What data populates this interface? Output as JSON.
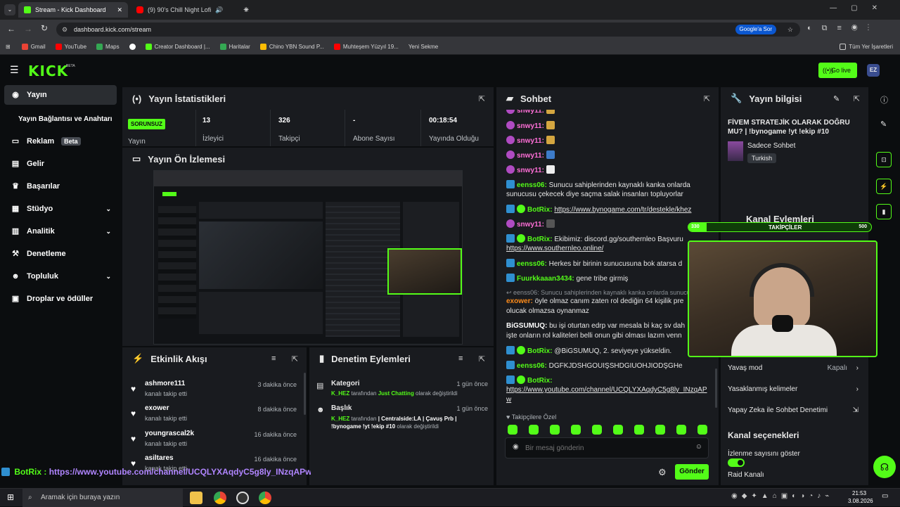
{
  "browser": {
    "tabs": [
      {
        "label": "Stream - Kick Dashboard"
      },
      {
        "label": "(9) 90's Chill Night Lofi"
      }
    ],
    "new_tab": "+",
    "url": "dashboard.kick.com/stream",
    "google_btn": "Google'a Sor",
    "bookmarks": [
      "Gmail",
      "YouTube",
      "Maps",
      "Creator Dashboard |...",
      "Haritalar",
      "Chino YBN Sound P...",
      "Muhteşem Yüzyıl 19...",
      "Yeni Sekme"
    ],
    "all_bookmarks": "Tüm Yer İşaretleri"
  },
  "app": {
    "logo": "KICK",
    "logo_beta": "BETA",
    "go_live": "Go live",
    "avatar": "EZ",
    "accent": "#53fc18"
  },
  "sidebar": {
    "items": [
      {
        "label": "Yayın",
        "icon": "broadcast-icon"
      },
      {
        "label": "Yayın Bağlantısı ve Anahtarı",
        "icon": ""
      },
      {
        "label": "Reklam",
        "badge": "Beta",
        "icon": "ad-icon"
      },
      {
        "label": "Gelir",
        "icon": "revenue-icon"
      },
      {
        "label": "Başarılar",
        "icon": "trophy-icon"
      },
      {
        "label": "Stüdyo",
        "icon": "studio-icon"
      },
      {
        "label": "Analitik",
        "icon": "chart-icon"
      },
      {
        "label": "Denetleme",
        "icon": "moderation-icon"
      },
      {
        "label": "Topluluk",
        "icon": "community-icon"
      },
      {
        "label": "Droplar ve ödüller",
        "icon": "drops-icon"
      }
    ]
  },
  "stats": {
    "title": "Yayın İstatistikleri",
    "status": "SORUNSUZ",
    "status_label": "Yayın",
    "viewers": "13",
    "viewers_label": "İzleyici",
    "followers": "326",
    "followers_label": "Takipçi",
    "subs": "-",
    "subs_label": "Abone Sayısı",
    "uptime": "00:18:54",
    "uptime_label": "Yayında Olduğu"
  },
  "preview": {
    "title": "Yayın Ön İzlemesi"
  },
  "events": {
    "title": "Etkinlik Akışı",
    "items": [
      {
        "name": "ashmore111",
        "sub": "kanalı takip etti",
        "time": "3 dakika önce"
      },
      {
        "name": "exower",
        "sub": "kanalı takip etti",
        "time": "8 dakika önce"
      },
      {
        "name": "youngrascal2k",
        "sub": "kanalı takip etti",
        "time": "16 dakika önce"
      },
      {
        "name": "asiltares",
        "sub": "kanalı takip etti",
        "time": "16 dakika önce"
      }
    ]
  },
  "modactions": {
    "title": "Denetim Eylemleri",
    "items": [
      {
        "title": "Kategori",
        "time": "1 gün önce",
        "user": "K_HEZ",
        "mid": " tarafından ",
        "value": "Just Chatting",
        "end": " olarak değiştirildi"
      },
      {
        "title": "Başlık",
        "time": "1 gün önce",
        "user": "K_HEZ",
        "mid": " tarafından ",
        "value": "| Centralside:LA | Çavuş Prb | !bynogame !yt !ekip #10",
        "end": " olarak değiştirildi"
      }
    ]
  },
  "chat": {
    "title": "Sohbet",
    "lines": [
      {
        "user": "snwy11:",
        "text": "",
        "ucolor": "#ff6fd8"
      },
      {
        "user": "snwy11:",
        "text": "",
        "ucolor": "#ff6fd8"
      },
      {
        "user": "snwy11:",
        "text": "",
        "ucolor": "#ff6fd8"
      },
      {
        "user": "snwy11:",
        "text": "",
        "ucolor": "#ff6fd8"
      },
      {
        "user": "snwy11:",
        "text": "",
        "ucolor": "#ff6fd8"
      },
      {
        "user": "eenss06:",
        "text": "Sunucu sahiplerinden kaynaklı kanka onlarda",
        "ucolor": "#53fc18"
      },
      {
        "user": "",
        "text": "sunucusu çekecek diye saçma salak insanları topluyorlar",
        "ucolor": "#53fc18"
      },
      {
        "user": "BotRix:",
        "text": "https://www.bynogame.com/tr/destekle/khez",
        "ucolor": "#53fc18"
      },
      {
        "user": "snwy11:",
        "text": "",
        "ucolor": "#ff6fd8"
      },
      {
        "user": "BotRix:",
        "text": "Ekibimiz: discord.gg/southernleo Başvuru",
        "ucolor": "#53fc18"
      },
      {
        "user": "",
        "text": "https://www.southernleo.online/",
        "ucolor": "#53fc18"
      },
      {
        "user": "eenss06:",
        "text": "Herkes bir birinin sunucusuna bok atarsa d",
        "ucolor": "#53fc18"
      },
      {
        "user": "Fuurkkaaan3434:",
        "text": "gene tribe girmiş",
        "ucolor": "#53fc18"
      },
      {
        "user": "",
        "text": "eenss06: Sunucu sahiplerinden kaynaklı kanka onlarda sunucu",
        "ucolor": "#888"
      },
      {
        "user": "exower:",
        "text": "öyle olmaz canım zaten rol dediğin 64 kişilik pre",
        "ucolor": "#ff8c1a"
      },
      {
        "user": "",
        "text": "olucak olmazsa oynanmaz",
        "ucolor": "#ff8c1a"
      },
      {
        "user": "BiGSUMUQ:",
        "text": "bu işi oturtan edrp var mesala bi kaç sv dah",
        "ucolor": "#ffffff"
      },
      {
        "user": "",
        "text": "işte onların rol kaliteleri belli onun gibi olması lazım venn",
        "ucolor": "#ffffff"
      },
      {
        "user": "BotRix:",
        "text": "@BiGSUMUQ, 2. seviyeye yükseldin.",
        "ucolor": "#53fc18"
      },
      {
        "user": "eenss06:",
        "text": "DGFKJDSHGOUIŞSHDGIUOHJIODŞGHe",
        "ucolor": "#53fc18"
      },
      {
        "user": "BotRix:",
        "text": "",
        "ucolor": "#53fc18"
      },
      {
        "user": "",
        "text": "https://www.youtube.com/channel/UCQLYXAqdyC5g8ly_INzqAP",
        "ucolor": "#53fc18"
      },
      {
        "user": "",
        "text": "w",
        "ucolor": "#53fc18"
      }
    ],
    "followers_only": "Takipçilere Özel",
    "placeholder": "Bir mesaj gönderin",
    "send": "Gönder"
  },
  "info": {
    "title": "Yayın bilgisi",
    "stream_title": "FİVEM STRATEJİK OLARAK DOĞRU MU? | !bynogame !yt !ekip #10",
    "category": "Sadece Sohbet",
    "language": "Turkish",
    "actions_title": "Kanal Eylemleri",
    "followers_bar_label": "TAKİPÇİLER",
    "followers_bar_min": "330",
    "followers_bar_max": "500",
    "followers_bar_progress": 0.1,
    "slow_mode": "Yavaş mod",
    "slow_mode_value": "Kapalı",
    "banned_words": "Yasaklanmış kelimeler",
    "ai_mod": "Yapay Zeka ile Sohbet Denetimi",
    "channel_options": "Kanal seçenekleri",
    "show_viewers": "İzlenme sayısını göster",
    "raid": "Raid Kanalı"
  },
  "overlay": {
    "user": "BotRix :",
    "text": "https://www.youtube.com/channel/UCQLYXAqdyC5g8ly_INzqAPw"
  },
  "taskbar": {
    "search": "Aramak için buraya yazın",
    "time": "21:53",
    "date": "3.08.2026"
  }
}
